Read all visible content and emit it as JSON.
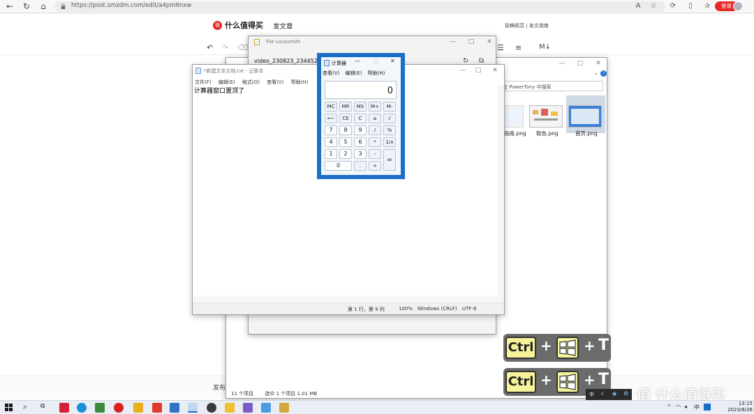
{
  "browser": {
    "url": "https://post.smzdm.com/edit/a4pm6nxw",
    "login_label": "登录"
  },
  "page": {
    "site_name": "什么值得买",
    "logo_char": "值",
    "post_title": "发文章",
    "header_links": "投稿规范 | 发文指南",
    "publish_label": "发布设",
    "zoom_label": "M↓"
  },
  "explorer": {
    "search_placeholder": "在 PowerTony 中搜索",
    "thumbs": [
      {
        "label": "指南.png"
      },
      {
        "label": "取色.png"
      },
      {
        "label": "首页.png"
      }
    ],
    "status_count": "11 个项目",
    "status_selected": "选中 1 个项目  1.01 MB"
  },
  "locksmith": {
    "title": "File Locksmith",
    "file_name": "video_230823_234452.mp4"
  },
  "notepad": {
    "title": "*新建文本文档.txt - 记事本",
    "menu": [
      "文件(F)",
      "编辑(E)",
      "格式(O)",
      "查看(V)",
      "帮助(H)"
    ],
    "text": "计算器窗口置顶了",
    "status_position": "第 1 行，第 9 列",
    "status_zoom": "100%",
    "status_eol": "Windows (CRLF)",
    "status_encoding": "UTF-8"
  },
  "calculator": {
    "title": "计算器",
    "menu": [
      "查看(V)",
      "编辑(E)",
      "帮助(H)"
    ],
    "display": "0",
    "keys": {
      "mc": "MC",
      "mr": "MR",
      "ms": "MS",
      "mplus": "M+",
      "mminus": "M-",
      "back": "⟵",
      "ce": "CE",
      "c": "C",
      "plusminus": "±",
      "sqrt": "√",
      "k7": "7",
      "k8": "8",
      "k9": "9",
      "div": "/",
      "pct": "%",
      "k4": "4",
      "k5": "5",
      "k6": "6",
      "mul": "*",
      "inv": "1/x",
      "k1": "1",
      "k2": "2",
      "k3": "3",
      "sub": "-",
      "eq": "=",
      "k0": "0",
      "dot": ".",
      "add": "+"
    }
  },
  "shortcut": {
    "ctrl": "Ctrl",
    "plus": "+",
    "key": "T"
  },
  "watermark": "值 什么值得买",
  "taskbar": {
    "ime": "中",
    "time": "13:15",
    "date": "2023/8/26"
  }
}
